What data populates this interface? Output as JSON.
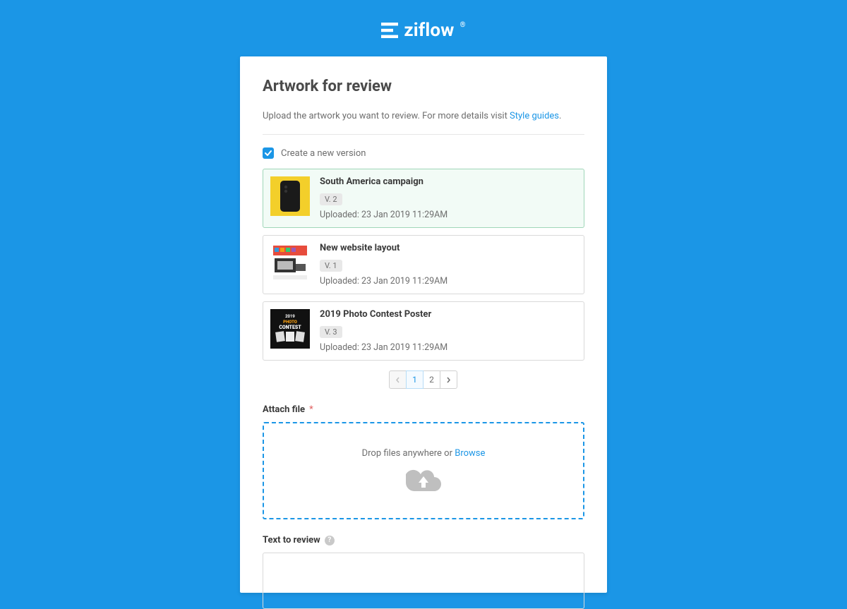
{
  "brand": "ziflow",
  "page_title": "Artwork for review",
  "intro_text": "Upload the artwork you want to review. For more details visit ",
  "intro_link": "Style guides",
  "intro_suffix": ".",
  "checkbox": {
    "checked": true,
    "label": "Create a new version"
  },
  "items": [
    {
      "title": "South America campaign",
      "version": "V. 2",
      "uploaded_prefix": "Uploaded: ",
      "uploaded": "23 Jan 2019 11:29AM",
      "selected": true
    },
    {
      "title": "New website layout",
      "version": "V. 1",
      "uploaded_prefix": "Uploaded: ",
      "uploaded": "23 Jan 2019 11:29AM",
      "selected": false
    },
    {
      "title": "2019 Photo Contest Poster",
      "version": "V. 3",
      "uploaded_prefix": "Uploaded: ",
      "uploaded": "23 Jan 2019 11:29AM",
      "selected": false
    }
  ],
  "pagination": {
    "pages": [
      "1",
      "2"
    ],
    "current": "1"
  },
  "attach": {
    "label": "Attach file",
    "required": "*",
    "drop_text": "Drop files anywhere or ",
    "browse": "Browse"
  },
  "text_review": {
    "label": "Text to review"
  }
}
